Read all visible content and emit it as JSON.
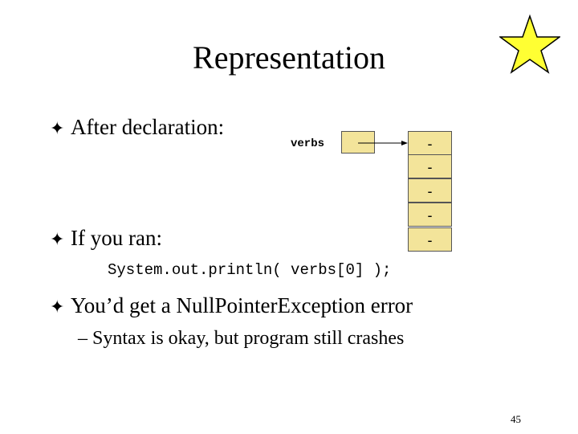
{
  "slide": {
    "title": "Representation",
    "bullets": [
      "After declaration:",
      "If you ran:",
      "You’d get a NullPointerException error"
    ],
    "bullet_marker": "✦",
    "code_line": "System.out.println( verbs[0] );",
    "sub_bullet": "– Syntax is okay, but program still crashes",
    "page_number": "45",
    "star_color": "#ffff33"
  },
  "diagram": {
    "variable_label": "verbs",
    "cells": [
      "-",
      "-",
      "-",
      "-",
      "-"
    ],
    "box_color": "#f3e49a"
  }
}
